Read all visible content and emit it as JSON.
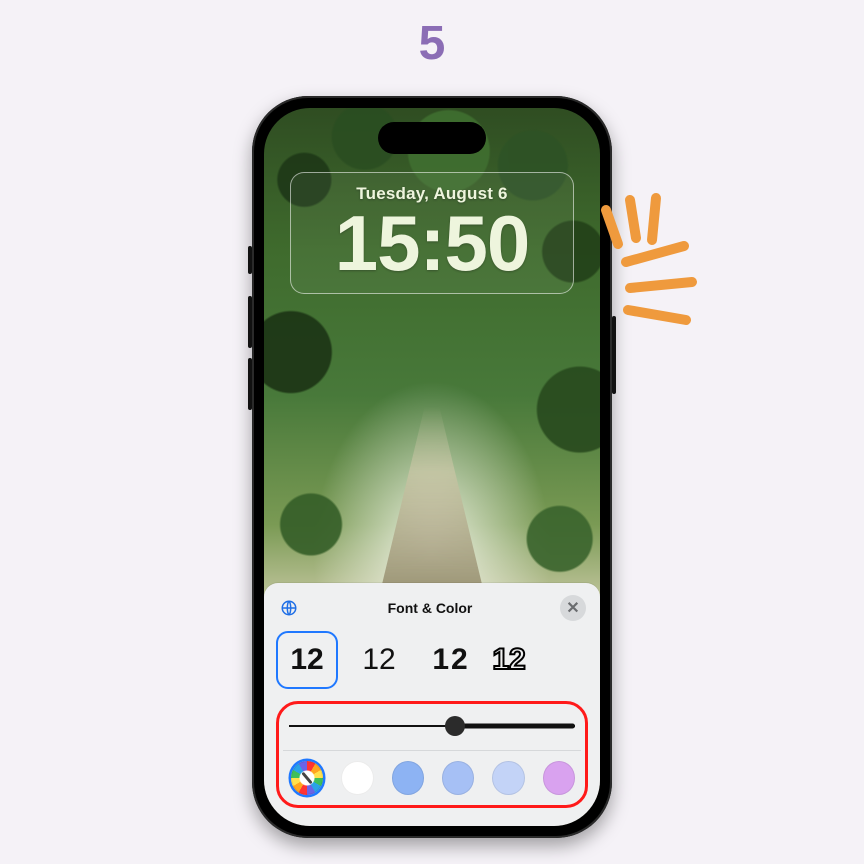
{
  "step": "5",
  "lockscreen": {
    "date": "Tuesday, August 6",
    "time": "15:50"
  },
  "sheet": {
    "title": "Font & Color",
    "close": "✕",
    "font_options": [
      "12",
      "12",
      "12",
      "12"
    ],
    "slider_value": 58,
    "colors": [
      {
        "name": "color-picker",
        "type": "picker",
        "hex": ""
      },
      {
        "name": "white",
        "hex": "#ffffff"
      },
      {
        "name": "cornflower",
        "hex": "#8db3f3"
      },
      {
        "name": "periwinkle",
        "hex": "#a6c0f5"
      },
      {
        "name": "lavender-blue",
        "hex": "#c3d3f7"
      },
      {
        "name": "orchid",
        "hex": "#d9a2ef"
      }
    ]
  },
  "accent": {
    "highlight": "#ff1a1a",
    "selection": "#1f78ff",
    "stroke": "#ef9a3d",
    "step_color": "#8b6db5"
  }
}
